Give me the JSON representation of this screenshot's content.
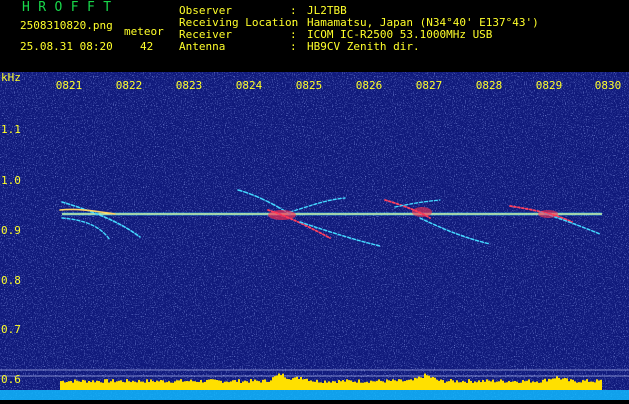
{
  "header": {
    "logo": "H R O F F T",
    "filename": "2508310820.png",
    "datetime": "25.08.31 08:20",
    "meteor_label": "meteor",
    "meteor_count": "42",
    "info": [
      {
        "key": "Observer",
        "value": "JL2TBB"
      },
      {
        "key": "Receiving Location",
        "value": "Hamamatsu, Japan (N34°40' E137°43')"
      },
      {
        "key": "Receiver",
        "value": "ICOM IC-R2500 53.1000MHz USB"
      },
      {
        "key": "Antenna",
        "value": "HB9CV Zenith dir."
      }
    ],
    "separator": ":"
  },
  "axes": {
    "y_unit": "kHz",
    "time_labels": [
      "0821",
      "0822",
      "0823",
      "0824",
      "0825",
      "0826",
      "0827",
      "0828",
      "0829",
      "0830"
    ],
    "freq_labels": [
      "1.1",
      "1.0",
      "0.9",
      "0.8",
      "0.7",
      "0.6"
    ]
  },
  "colors": {
    "background": "#101a7c",
    "text": "#ffff2a",
    "logo": "#18d84a",
    "carrier": "#c8ffb0",
    "noise_band": "#ffe000"
  }
}
